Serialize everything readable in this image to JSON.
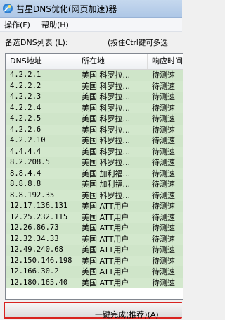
{
  "window": {
    "title": "彗星DNS优化(网页加速)器"
  },
  "menu": [
    {
      "label": "操作(F)"
    },
    {
      "label": "帮助(H)"
    }
  ],
  "list": {
    "caption": "备选DNS列表 (L):",
    "hint": "(按住Ctrl键可多选",
    "columns": [
      "DNS地址",
      "所在地",
      "响应时间"
    ],
    "rows": [
      [
        "4.2.2.1",
        "美国 科罗拉...",
        "待测速"
      ],
      [
        "4.2.2.2",
        "美国 科罗拉...",
        "待测速"
      ],
      [
        "4.2.2.3",
        "美国 科罗拉...",
        "待测速"
      ],
      [
        "4.2.2.4",
        "美国 科罗拉...",
        "待测速"
      ],
      [
        "4.2.2.5",
        "美国 科罗拉...",
        "待测速"
      ],
      [
        "4.2.2.6",
        "美国 科罗拉...",
        "待测速"
      ],
      [
        "4.2.2.10",
        "美国 科罗拉...",
        "待测速"
      ],
      [
        "4.4.4.4",
        "美国 科罗拉...",
        "待测速"
      ],
      [
        "8.2.208.5",
        "美国 科罗拉...",
        "待测速"
      ],
      [
        "8.8.4.4",
        "美国 加利福...",
        "待测速"
      ],
      [
        "8.8.8.8",
        "美国 加利福...",
        "待测速"
      ],
      [
        "8.8.192.35",
        "美国 科罗拉...",
        "待测速"
      ],
      [
        "12.17.136.131",
        "美国 ATT用户",
        "待测速"
      ],
      [
        "12.25.232.115",
        "美国 ATT用户",
        "待测速"
      ],
      [
        "12.26.86.73",
        "美国 ATT用户",
        "待测速"
      ],
      [
        "12.32.34.33",
        "美国 ATT用户",
        "待测速"
      ],
      [
        "12.49.240.68",
        "美国 ATT用户",
        "待测速"
      ],
      [
        "12.150.146.198",
        "美国 ATT用户",
        "待测速"
      ],
      [
        "12.166.30.2",
        "美国 ATT用户",
        "待测速"
      ],
      [
        "12.180.165.40",
        "美国 ATT用户",
        "待测速"
      ]
    ]
  },
  "button": {
    "label": "一键完成(推荐)(A)"
  },
  "colors": {
    "row_bg": "#cfe5c9",
    "button_border": "#d8231f",
    "titlebar": "#c5d8ee"
  },
  "icons": {
    "app": "comet-app-icon"
  }
}
